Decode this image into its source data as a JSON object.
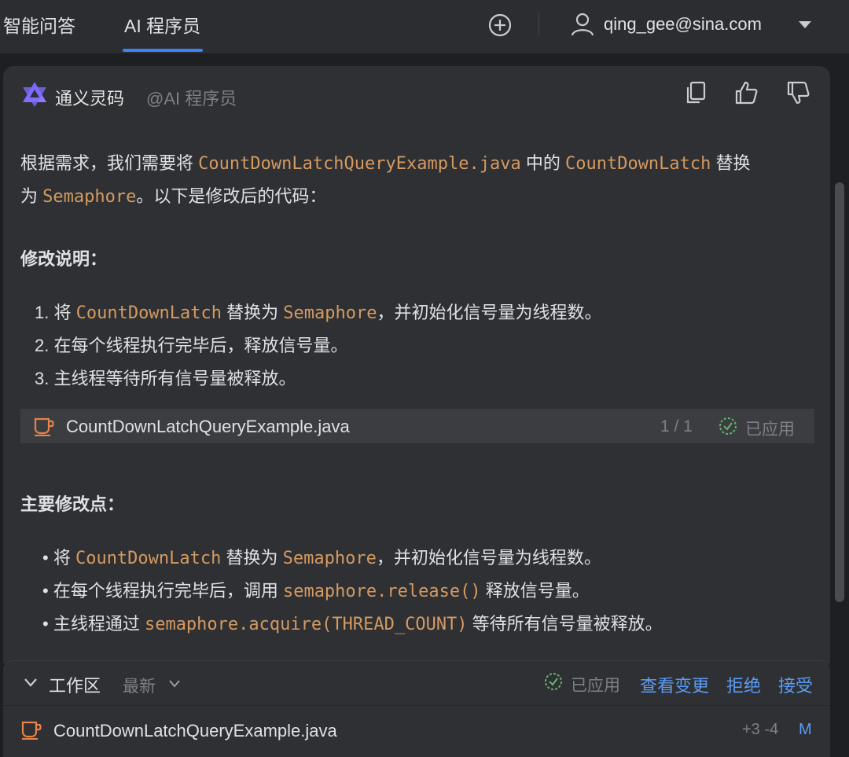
{
  "header": {
    "tabs": [
      {
        "label": "智能问答",
        "active": false
      },
      {
        "label": "AI 程序员",
        "active": true
      }
    ],
    "user_email": "qing_gee@sina.com",
    "icons": [
      "plus-circle-icon",
      "user-icon",
      "chevron-down-icon"
    ]
  },
  "message": {
    "author": "通义灵码",
    "mention": "@AI 程序员",
    "actions": [
      "copy-icon",
      "thumbs-up-icon",
      "thumbs-down-icon"
    ],
    "intro": {
      "t1": "根据需求，我们需要将 ",
      "c1": "CountDownLatchQueryExample.java",
      "t2": " 中的 ",
      "c2": "CountDownLatch",
      "t3": " 替换",
      "t4": "为 ",
      "c3": "Semaphore",
      "t5": "。以下是修改后的代码："
    },
    "section1_title": "修改说明：",
    "numbered": [
      {
        "num": "1.",
        "t1": " 将 ",
        "c1": "CountDownLatch",
        "t2": " 替换为 ",
        "c2": "Semaphore",
        "t3": "，并初始化信号量为线程数。"
      },
      {
        "num": "2.",
        "t1": " 在每个线程执行完毕后，释放信号量。"
      },
      {
        "num": "3.",
        "t1": " 主线程等待所有信号量被释放。"
      }
    ],
    "file_bar": {
      "name": "CountDownLatchQueryExample.java",
      "count": "1 / 1",
      "status": "已应用"
    },
    "section2_title": "主要修改点：",
    "bullets": [
      {
        "t1": "将 ",
        "c1": "CountDownLatch",
        "t2": " 替换为 ",
        "c2": "Semaphore",
        "t3": "，并初始化信号量为线程数。"
      },
      {
        "t1": "在每个线程执行完毕后，调用 ",
        "c1": "semaphore.release()",
        "t2": " 释放信号量。"
      },
      {
        "t1": "主线程通过 ",
        "c1": "semaphore.acquire(THREAD_COUNT)",
        "t2": " 等待所有信号量被释放。"
      }
    ]
  },
  "workspace": {
    "title": "工作区",
    "filter": "最新",
    "status": "已应用",
    "view_changes": "查看变更",
    "reject": "拒绝",
    "accept": "接受",
    "file": {
      "name": "CountDownLatchQueryExample.java",
      "diff": "+3 -4",
      "state": "M"
    }
  },
  "colors": {
    "background": "#1e1f22",
    "card": "#2e3033",
    "code": "#d59a62",
    "link": "#5b9cf5",
    "accent": "#3b82f6",
    "file_icon": "#e8834a",
    "applied": "#5fb865"
  }
}
